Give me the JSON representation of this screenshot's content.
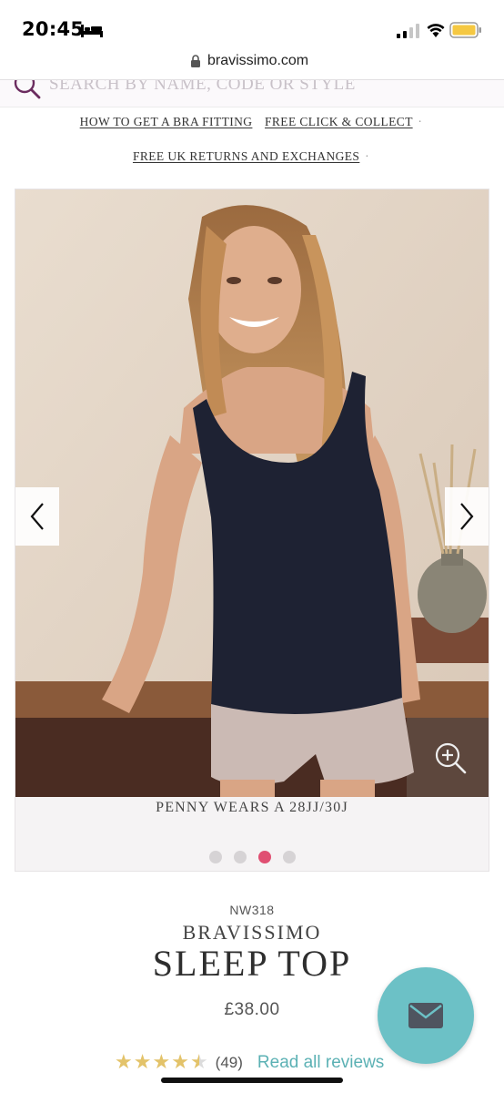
{
  "status_bar": {
    "time": "20:45",
    "icons": [
      "bed-icon",
      "signal-icon",
      "wifi-icon",
      "battery-icon"
    ],
    "battery_color": "#f5c842"
  },
  "browser": {
    "url": "bravissimo.com",
    "lock_icon": "lock-icon"
  },
  "search": {
    "placeholder": "SEARCH BY NAME, CODE OR STYLE",
    "icon": "search-icon",
    "icon_color": "#6b2c5f"
  },
  "promo_links": {
    "bra_fitting": "HOW TO GET A BRA FITTING",
    "click_collect": "FREE CLICK & COLLECT",
    "returns": "FREE UK RETURNS AND EXCHANGES",
    "separator": "·"
  },
  "gallery": {
    "caption": "PENNY WEARS A 28JJ/30J",
    "slide_count": 4,
    "active_slide": 3,
    "active_dot_color": "#e04f72",
    "prev_icon": "chevron-left-icon",
    "next_icon": "chevron-right-icon",
    "zoom_icon": "zoom-in-icon"
  },
  "product": {
    "sku": "NW318",
    "brand": "BRAVISSIMO",
    "title": "SLEEP TOP",
    "price": "£38.00",
    "rating": 4.5,
    "review_count": "(49)",
    "reviews_link": "Read all reviews",
    "link_color": "#5bb1b4"
  },
  "fab": {
    "icon": "mail-icon",
    "color": "#6cc1c6"
  }
}
